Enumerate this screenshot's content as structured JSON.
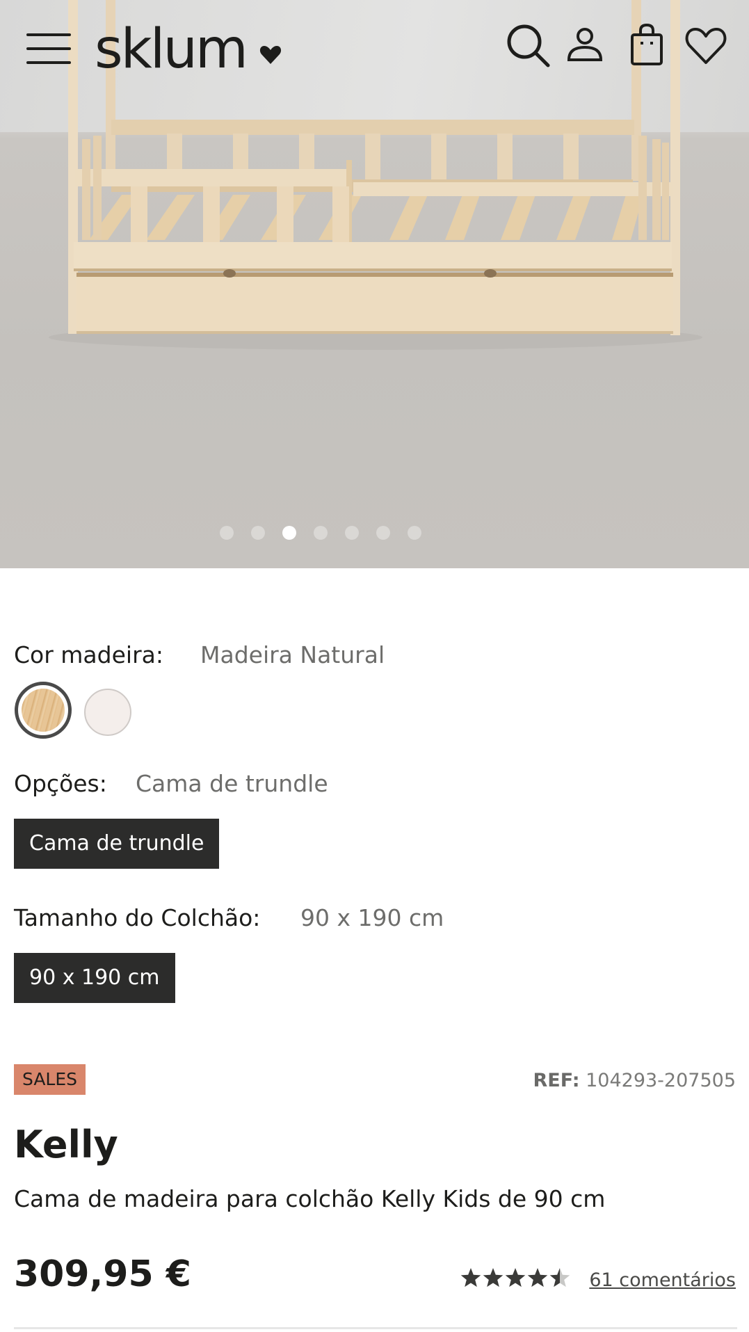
{
  "header": {
    "logo_text": "sklum",
    "icons": [
      "menu-icon",
      "search-icon",
      "user-icon",
      "bag-icon",
      "heart-icon"
    ]
  },
  "gallery": {
    "image_alt": "Kelly wooden house bed with trundle",
    "slide_count": 7,
    "active_slide": 3
  },
  "options": {
    "wood_color": {
      "label": "Cor madeira:",
      "value": "Madeira Natural",
      "swatches": [
        "natural-wood",
        "white"
      ]
    },
    "option": {
      "label": "Opções:",
      "value": "Cama de trundle",
      "chip": "Cama de trundle"
    },
    "mattress": {
      "label": "Tamanho do Colchão:",
      "value": "90 x 190 cm",
      "chip": "90 x 190 cm"
    }
  },
  "product": {
    "badge": "SALES",
    "ref_label": "REF:",
    "ref_value": "104293-207505",
    "name": "Kelly",
    "description": "Cama de madeira para colchão Kelly Kids de 90 cm",
    "price": "309,95 €",
    "rating": 4.5,
    "reviews": "61 comentários"
  },
  "colors": {
    "text": "#1d1d1b",
    "muted": "#6d6d6b",
    "badge": "#d9866b",
    "chip": "#2c2c2b"
  }
}
